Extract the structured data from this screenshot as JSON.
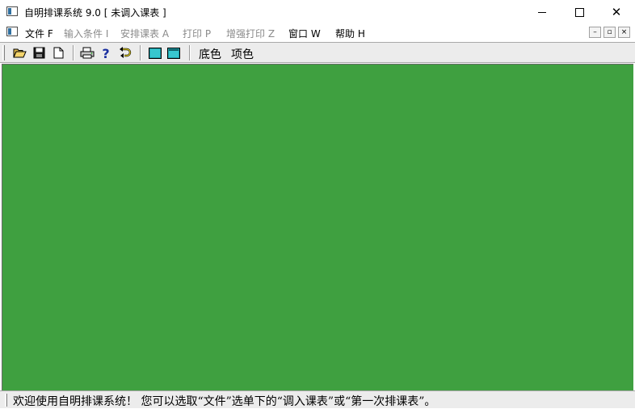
{
  "window": {
    "title": "自明排课系统 9.0 [ 未调入课表 ]",
    "controls": {
      "minimize": "minimize",
      "maximize": "maximize",
      "close": "✕"
    }
  },
  "menu": {
    "items": [
      {
        "label": "文件 F",
        "enabled": true
      },
      {
        "label": "输入条件 I",
        "enabled": false
      },
      {
        "label": "安排课表 A",
        "enabled": false
      },
      {
        "label": "打印 P",
        "enabled": false
      },
      {
        "label": "增强打印 Z",
        "enabled": false
      },
      {
        "label": "窗口 W",
        "enabled": true
      },
      {
        "label": "帮助 H",
        "enabled": true
      }
    ],
    "mdi_controls": {
      "minimize": "–",
      "restore": "▫",
      "close": "×"
    }
  },
  "toolbar": {
    "icons": [
      "open-folder-icon",
      "save-disk-icon",
      "new-document-icon",
      "printer-icon",
      "help-question-icon",
      "undo-arrow-icon",
      "panel-a-icon",
      "panel-b-icon"
    ],
    "base_color_label": "底色",
    "top_color_label": "项色"
  },
  "colors": {
    "workspace": "#3fa040",
    "chrome": "#ececec",
    "disabled_text": "#8a8a8a"
  },
  "status": {
    "message": "欢迎使用自明排课系统！ 您可以选取“文件”选单下的“调入课表”或“第一次排课表”。"
  }
}
